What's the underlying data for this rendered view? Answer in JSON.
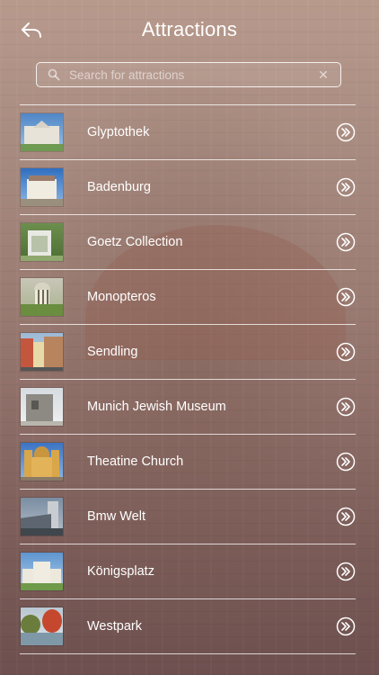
{
  "header": {
    "title": "Attractions"
  },
  "search": {
    "placeholder": "Search for attractions",
    "value": ""
  },
  "attractions": [
    {
      "label": "Glyptothek",
      "thumb": "glyptothek-photo"
    },
    {
      "label": "Badenburg",
      "thumb": "badenburg-photo"
    },
    {
      "label": "Goetz Collection",
      "thumb": "goetz-collection-photo"
    },
    {
      "label": "Monopteros",
      "thumb": "monopteros-photo"
    },
    {
      "label": "Sendling",
      "thumb": "sendling-photo"
    },
    {
      "label": "Munich Jewish Museum",
      "thumb": "munich-jewish-museum-photo"
    },
    {
      "label": "Theatine Church",
      "thumb": "theatine-church-photo"
    },
    {
      "label": "Bmw Welt",
      "thumb": "bmw-welt-photo"
    },
    {
      "label": "Königsplatz",
      "thumb": "koenigsplatz-photo"
    },
    {
      "label": "Westpark",
      "thumb": "westpark-photo"
    }
  ],
  "icons": {
    "back": "back-arrow-icon",
    "search": "search-icon",
    "clear": "clear-icon",
    "row_action": "double-chevron-right-icon"
  }
}
